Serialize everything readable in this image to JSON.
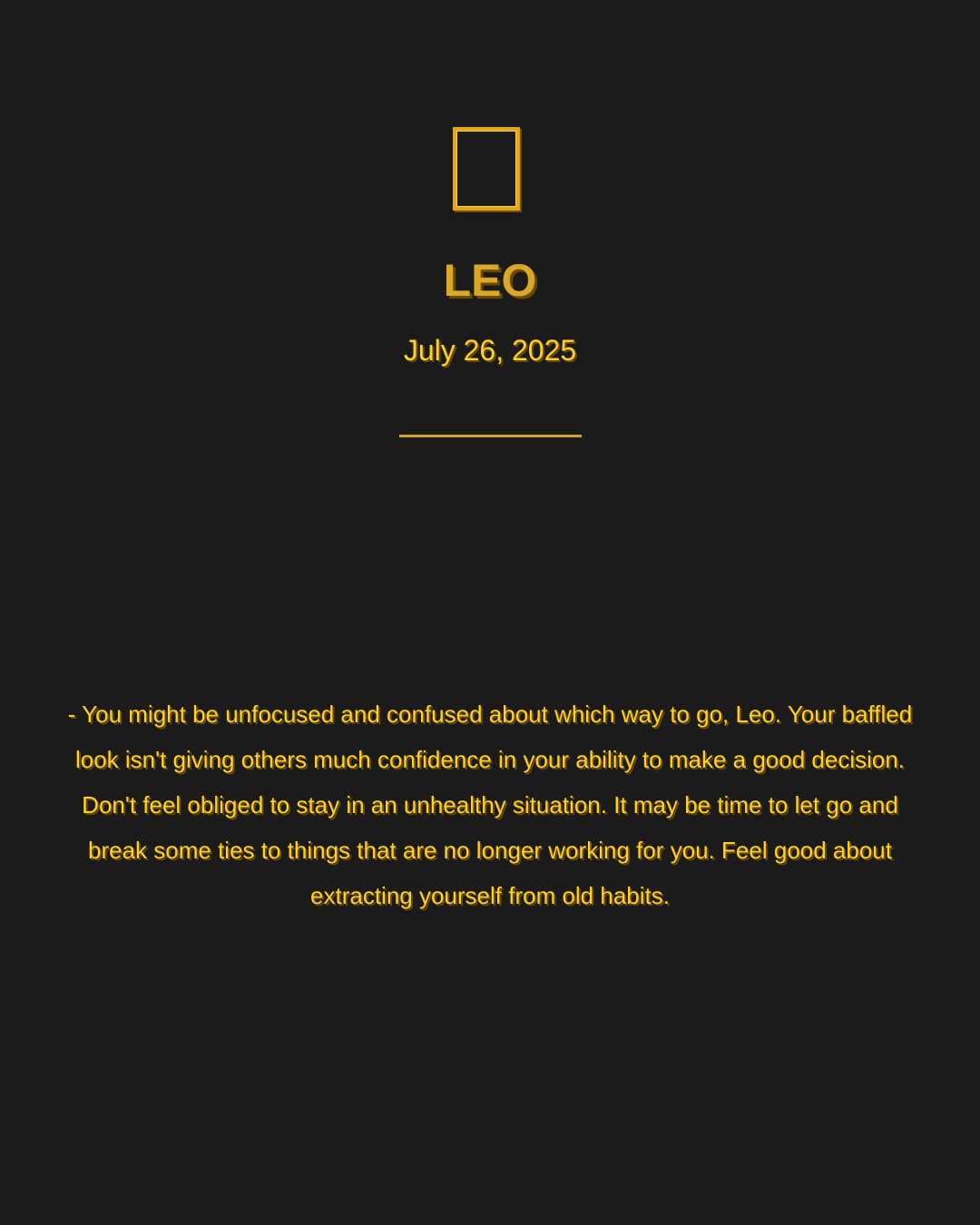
{
  "card": {
    "glyph_icon": "zodiac-leo-missing-glyph-box",
    "sign_name": "LEO",
    "date": "July 26, 2025",
    "horoscope": "- You might be unfocused and confused about which way to go, Leo. Your baffled look isn't giving others much confidence in your ability to make a good decision. Don't feel obliged to stay in an unhealthy situation. It may be time to let go and break some ties to things that are no longer working for you. Feel good about extracting yourself from old habits."
  },
  "colors": {
    "background": "#1b1b1b",
    "gold": "#ffd12e",
    "gold_dark": "#d9a82a",
    "shadow": "#6b4a00"
  }
}
